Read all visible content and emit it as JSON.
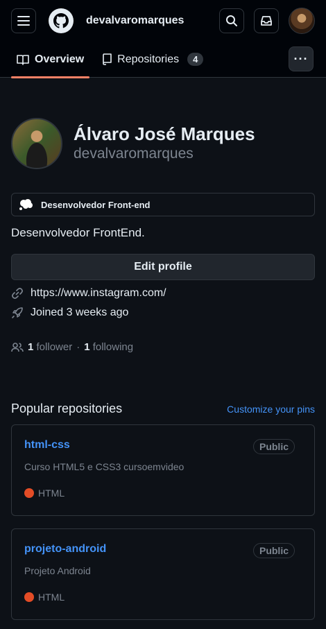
{
  "header": {
    "username": "devalvaromarques"
  },
  "tabs": [
    {
      "label": "Overview"
    },
    {
      "label": "Repositories",
      "count": "4"
    }
  ],
  "profile": {
    "full_name": "Álvaro José Marques",
    "login": "devalvaromarques",
    "status": "Desenvolvedor Front-end",
    "bio": "Desenvolvedor FrontEnd.",
    "edit_label": "Edit profile",
    "link": "https://www.instagram.com/",
    "joined": "Joined 3 weeks ago",
    "followers_count": "1",
    "followers_label": "follower",
    "following_count": "1",
    "following_label": "following",
    "separator": "·"
  },
  "popular": {
    "title": "Popular repositories",
    "customize_label": "Customize your pins",
    "repos": [
      {
        "name": "html-css",
        "visibility": "Public",
        "description": "Curso HTML5 e CSS3 cursoemvideo",
        "language": "HTML",
        "language_color": "#e34c26"
      },
      {
        "name": "projeto-android",
        "visibility": "Public",
        "description": "Projeto Android",
        "language": "HTML",
        "language_color": "#e34c26"
      }
    ]
  },
  "colors": {
    "accent_link": "#4493f8",
    "tab_underline": "#f78166",
    "background": "#0d1117"
  }
}
